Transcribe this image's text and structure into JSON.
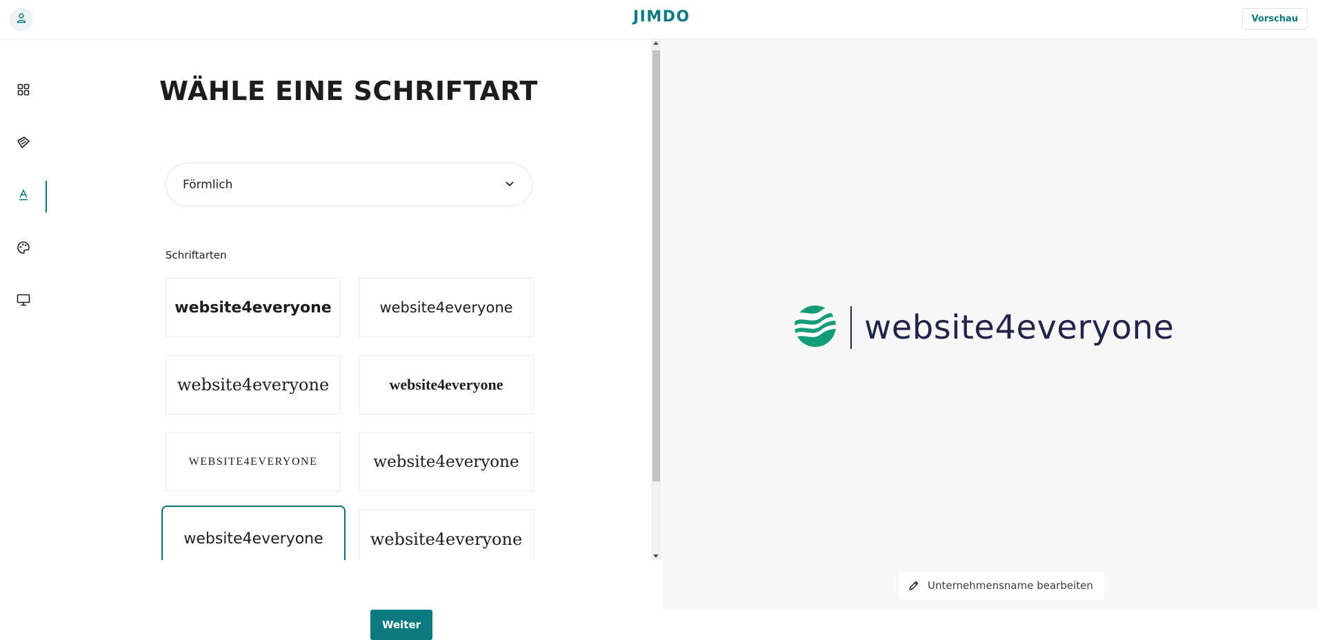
{
  "header": {
    "logo": "JIMDO",
    "preview_label": "Vorschau"
  },
  "rail": {
    "items": [
      {
        "name": "grid-icon",
        "active": false
      },
      {
        "name": "style-icon",
        "active": false
      },
      {
        "name": "font-icon",
        "active": true
      },
      {
        "name": "palette-icon",
        "active": false
      },
      {
        "name": "monitor-icon",
        "active": false
      }
    ]
  },
  "panel": {
    "heading": "WÄHLE EINE SCHRIFTART",
    "select_value": "Förmlich",
    "section_label": "Schriftarten",
    "font_cards": [
      {
        "text": "website4everyone",
        "selected": false
      },
      {
        "text": "website4everyone",
        "selected": false
      },
      {
        "text": "website4everyone",
        "selected": false
      },
      {
        "text": "website4everyone",
        "selected": false
      },
      {
        "text": "WEBSITE4EVERYONE",
        "selected": false
      },
      {
        "text": "website4everyone",
        "selected": false
      },
      {
        "text": "website4everyone",
        "selected": true
      },
      {
        "text": "website4everyone",
        "selected": false
      }
    ],
    "next_label": "Weiter"
  },
  "preview": {
    "brand_name": "website4everyone",
    "edit_label": "Unternehmensname bearbeiten"
  },
  "colors": {
    "accent": "#0b7a7f",
    "brand_text": "#23244a",
    "logo_green": "#139c78"
  }
}
